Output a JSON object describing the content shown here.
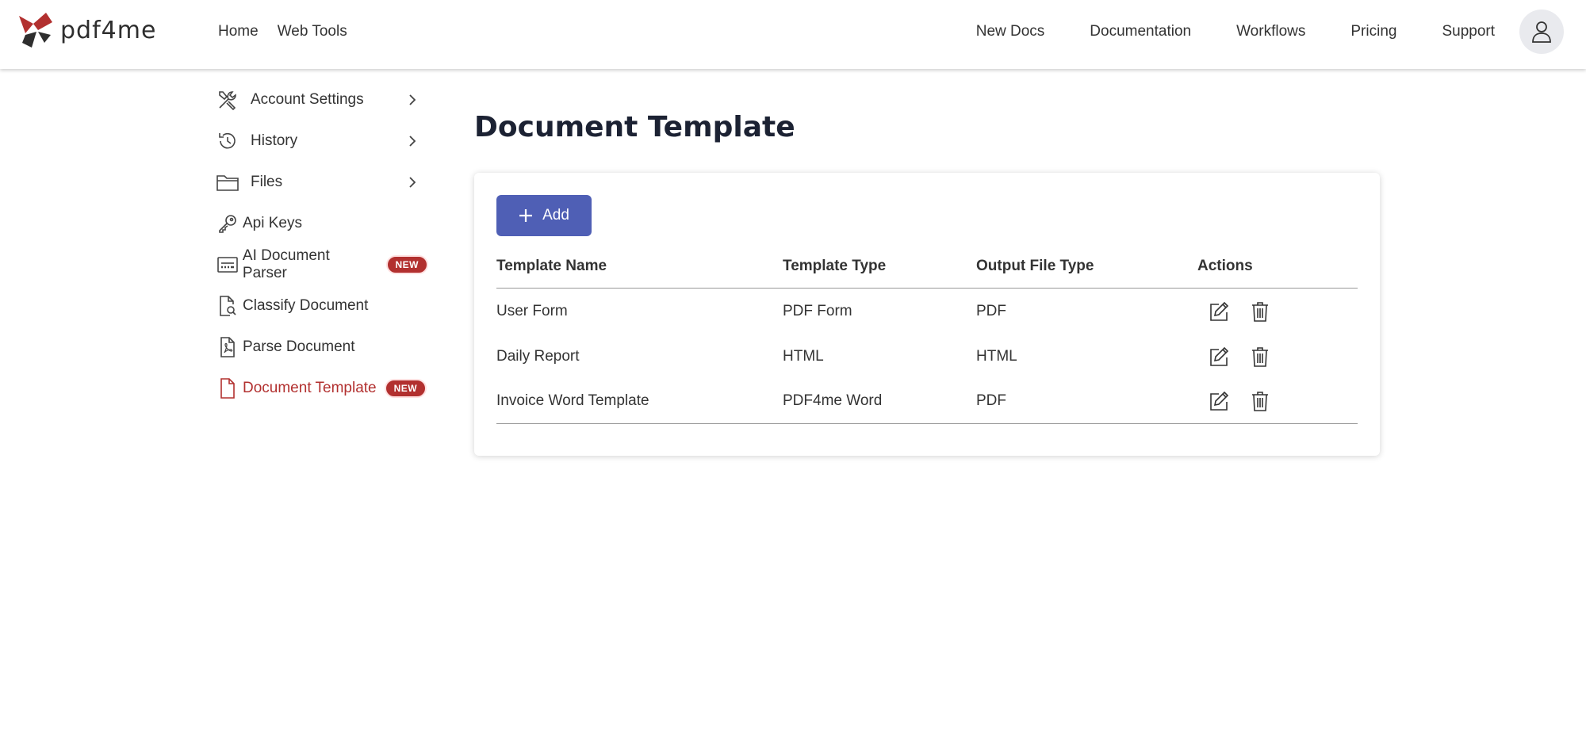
{
  "header": {
    "logo_text": "pdf4me",
    "nav_left": [
      "Home",
      "Web Tools"
    ],
    "nav_right": [
      "New Docs",
      "Documentation",
      "Workflows",
      "Pricing",
      "Support"
    ],
    "avatar_icon": "user-icon"
  },
  "sidebar": {
    "items": [
      {
        "label": "Account Settings",
        "icon": "tools-icon",
        "chevron": true
      },
      {
        "label": "History",
        "icon": "history-icon",
        "chevron": true
      },
      {
        "label": "Files",
        "icon": "folder-icon",
        "chevron": true
      },
      {
        "label": "Api Keys",
        "icon": "key-icon"
      },
      {
        "label": "AI Document Parser",
        "icon": "scanner-icon",
        "badge": "NEW"
      },
      {
        "label": "Classify Document",
        "icon": "document-search-icon"
      },
      {
        "label": "Parse Document",
        "icon": "pdf-document-icon"
      },
      {
        "label": "Document Template",
        "icon": "document-icon",
        "badge": "NEW",
        "active": true
      }
    ]
  },
  "main": {
    "title": "Document Template",
    "add_label": "Add",
    "columns": [
      "Template Name",
      "Template Type",
      "Output File Type",
      "Actions"
    ],
    "rows": [
      {
        "name": "User Form",
        "type": "PDF Form",
        "output": "PDF"
      },
      {
        "name": "Daily Report",
        "type": "HTML",
        "output": "HTML"
      },
      {
        "name": "Invoice Word Template",
        "type": "PDF4me Word",
        "output": "PDF"
      }
    ]
  },
  "colors": {
    "accent": "#b2302f",
    "button": "#4f5fb5",
    "title": "#1c2233"
  }
}
